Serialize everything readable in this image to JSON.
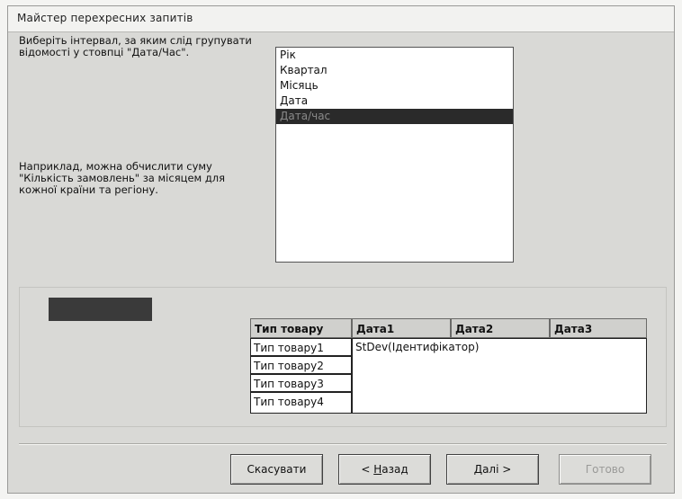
{
  "window": {
    "title": "Майстер перехресних запитів"
  },
  "instructions": {
    "text": "Виберіть інтервал, за яким слід групувати відомості у стовпці \"Дата/Час\".",
    "example": "Наприклад, можна обчислити суму \"Кількість замовлень\" за місяцем для кожної країни та регіону."
  },
  "interval_list": {
    "items": [
      "Рік",
      "Квартал",
      "Місяць",
      "Дата",
      "Дата/час"
    ],
    "selected_index": 4
  },
  "preview": {
    "row_header": "Тип товару",
    "columns": [
      "Дата1",
      "Дата2",
      "Дата3"
    ],
    "rows": [
      "Тип товару1",
      "Тип товару2",
      "Тип товару3",
      "Тип товару4"
    ],
    "value": "StDev(Ідентифікатор)"
  },
  "buttons": {
    "cancel": "Скасувати",
    "back_prefix": "< ",
    "back_hot": "Н",
    "back_rest": "азад",
    "next": "Далі >",
    "finish": "Готово"
  }
}
